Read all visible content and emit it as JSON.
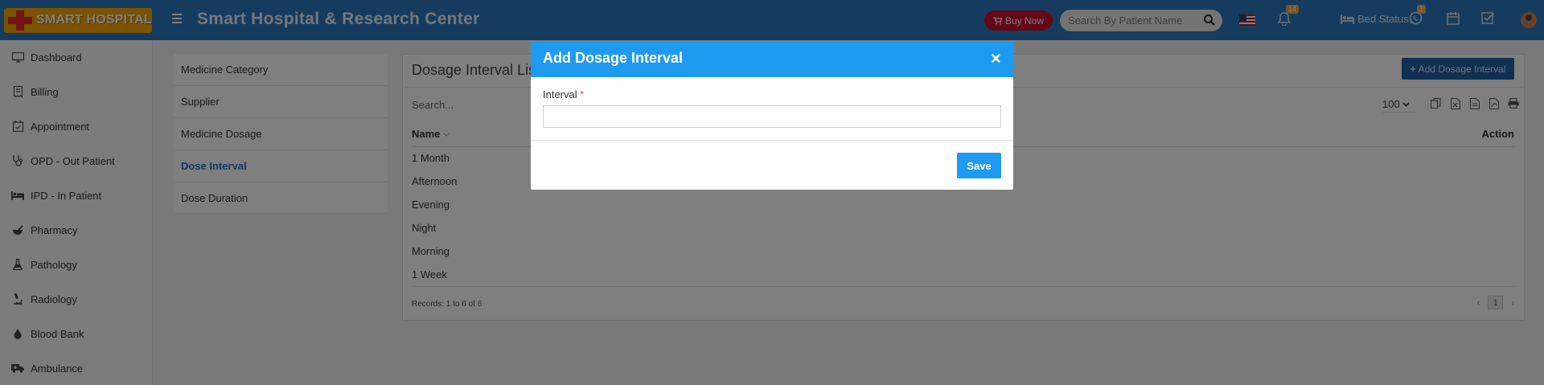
{
  "header": {
    "logo_text": "SMART HOSPITAL",
    "title": "Smart Hospital & Research Center",
    "buy_now": "Buy Now",
    "search_placeholder": "Search By Patient Name",
    "notification_count": "14",
    "whatsapp_count": "1",
    "bed_status": "Bed Status"
  },
  "sidebar": {
    "items": [
      {
        "label": "Dashboard",
        "icon": "desktop-icon"
      },
      {
        "label": "Billing",
        "icon": "receipt-icon"
      },
      {
        "label": "Appointment",
        "icon": "calendar-check-icon"
      },
      {
        "label": "OPD - Out Patient",
        "icon": "stethoscope-icon"
      },
      {
        "label": "IPD - In Patient",
        "icon": "bed-icon"
      },
      {
        "label": "Pharmacy",
        "icon": "mortar-pestle-icon"
      },
      {
        "label": "Pathology",
        "icon": "flask-icon"
      },
      {
        "label": "Radiology",
        "icon": "microscope-icon"
      },
      {
        "label": "Blood Bank",
        "icon": "tint-icon"
      },
      {
        "label": "Ambulance",
        "icon": "ambulance-icon"
      }
    ]
  },
  "submenu": {
    "items": [
      {
        "label": "Medicine Category",
        "active": false
      },
      {
        "label": "Supplier",
        "active": false
      },
      {
        "label": "Medicine Dosage",
        "active": false
      },
      {
        "label": "Dose Interval",
        "active": true
      },
      {
        "label": "Dose Duration",
        "active": false
      }
    ]
  },
  "list": {
    "title": "Dosage Interval List",
    "add_button": "Add Dosage Interval",
    "search_placeholder": "Search...",
    "page_size": "100",
    "col_name": "Name",
    "col_action": "Action",
    "rows": [
      "1 Month",
      "Afternoon",
      "Evening",
      "Night",
      "Morning",
      "1 Week"
    ],
    "records": "Records: 1 to 6 of 6",
    "current_page": "1"
  },
  "modal": {
    "title": "Add Dosage Interval",
    "field_label": "Interval",
    "required_mark": "*",
    "input_value": "",
    "save": "Save"
  },
  "colors": {
    "topbar": "#2a78bd",
    "modal_header": "#1e9af0",
    "buy_now": "#c8102e",
    "active_link": "#1a73c9"
  }
}
